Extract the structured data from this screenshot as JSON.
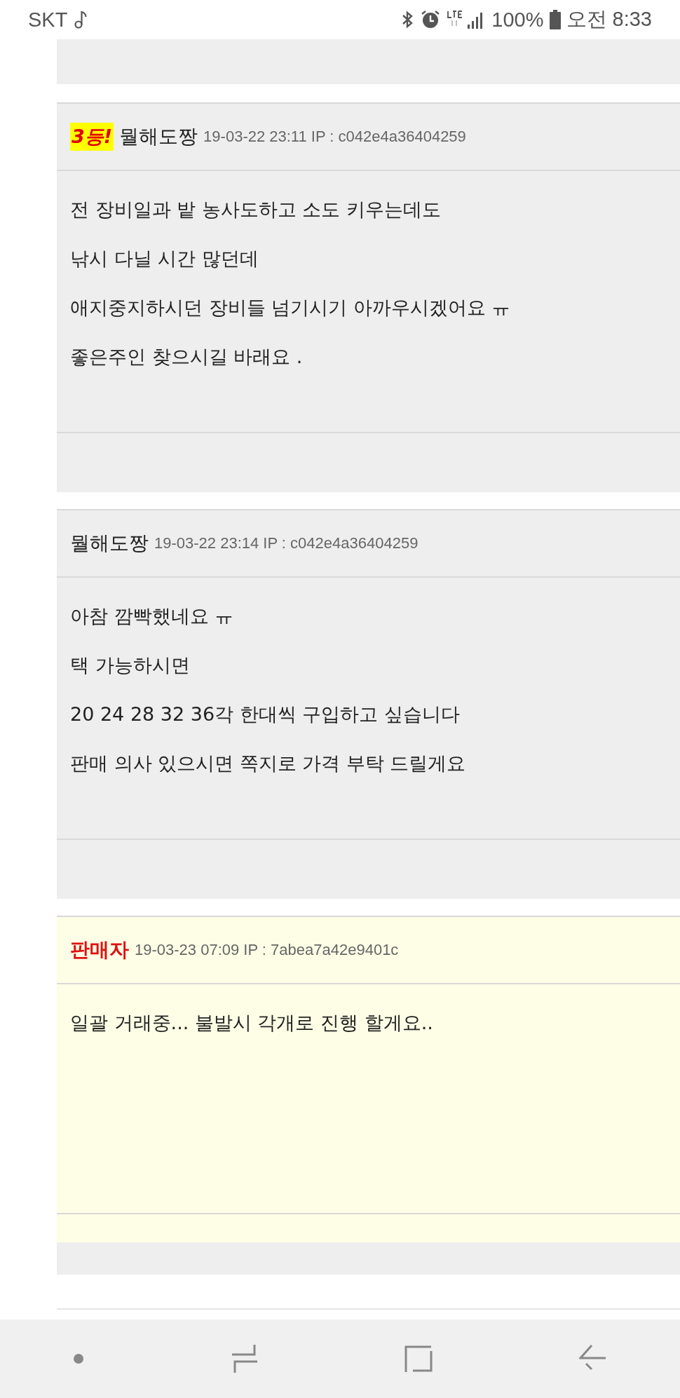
{
  "status_bar": {
    "carrier": "SKT",
    "battery": "100%",
    "time": "오전 8:33"
  },
  "comments": [
    {
      "badge": "3등!",
      "author": "뭘해도짱",
      "is_seller": false,
      "meta": "19-03-22 23:11 IP : c042e4a36404259",
      "lines": [
        "전 장비일과 밭 농사도하고 소도 키우는데도",
        "낚시 다닐 시간 많던데",
        "애지중지하시던 장비들 넘기시기 아까우시겠어요 ㅠ",
        "좋은주인 찾으시길 바래요 ."
      ]
    },
    {
      "author": "뭘해도짱",
      "is_seller": false,
      "meta": "19-03-22 23:14 IP : c042e4a36404259",
      "lines": [
        "아참 깜빡했네요 ㅠ",
        "택 가능하시면",
        "20 24 28 32 36각 한대씩 구입하고 싶습니다",
        "판매 의사 있으시면 쪽지로 가격 부탁 드릴게요"
      ]
    },
    {
      "author": "판매자",
      "is_seller": true,
      "meta": "19-03-23 07:09 IP : 7abea7a42e9401c",
      "lines": [
        "일괄 거래중... 불발시 각개로 진행 할게요.."
      ]
    }
  ]
}
